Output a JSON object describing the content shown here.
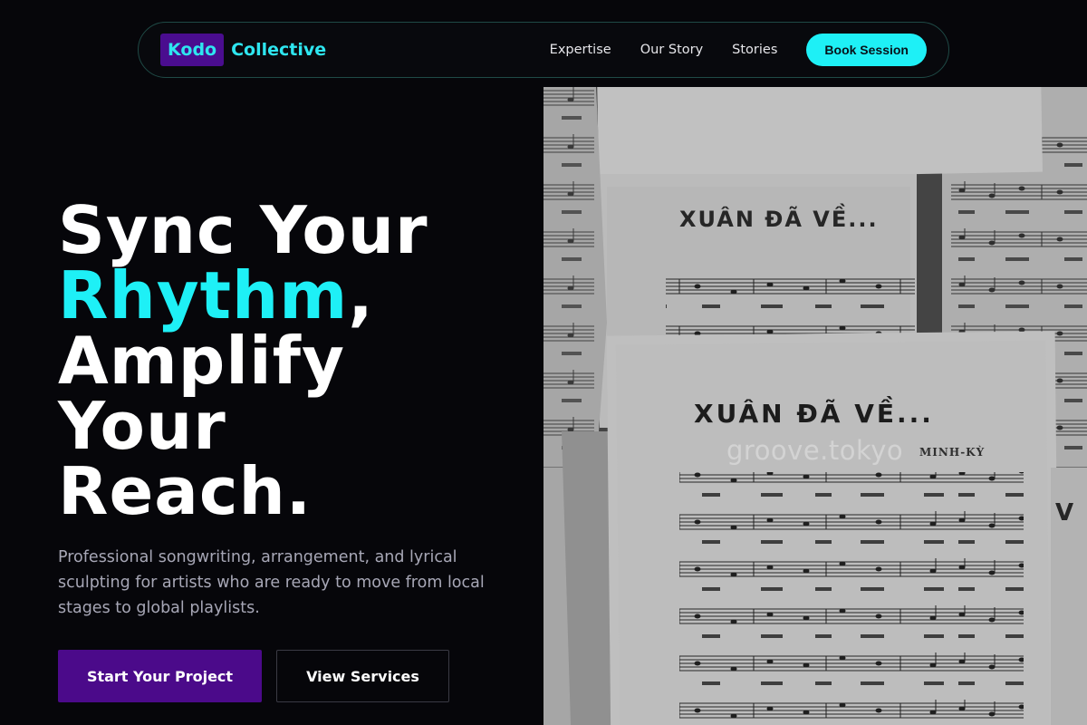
{
  "brand": {
    "logo_box": "Kodo",
    "logo_text": "Collective"
  },
  "nav": {
    "links": [
      "Expertise",
      "Our Story",
      "Stories"
    ],
    "cta": "Book Session"
  },
  "hero": {
    "title_line1": "Sync Your",
    "title_accent": "Rhythm",
    "title_comma": ",",
    "title_line3": "Amplify",
    "title_line4": "Your",
    "title_line5": "Reach.",
    "subtitle": "Professional songwriting, arrangement, and lyrical sculpting for artists who are ready to move from local stages to global playlists.",
    "primary_button": "Start Your Project",
    "secondary_button": "View Services"
  },
  "image": {
    "watermark": "groove.tokyo",
    "sheet_title": "XUÂN ĐÃ VỀ...",
    "composer": "MINH-KỲ"
  },
  "colors": {
    "accent": "#1ef0f6",
    "brand_purple": "#4b0a8a",
    "background": "#06060a"
  }
}
